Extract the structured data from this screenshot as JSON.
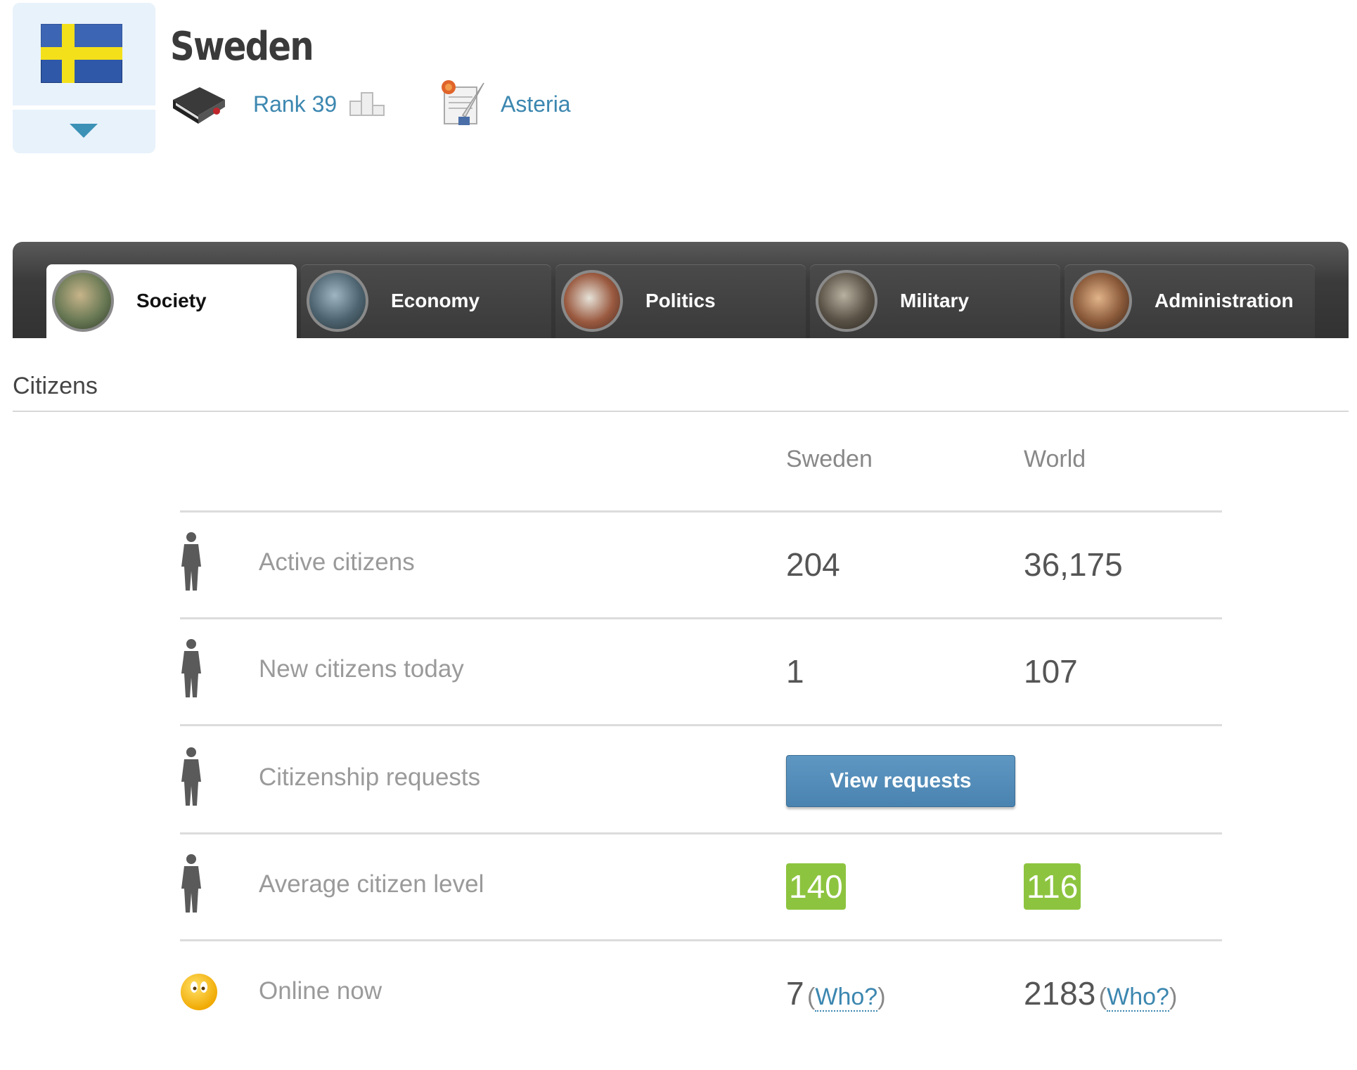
{
  "header": {
    "country": "Sweden",
    "rank_label": "Rank 39",
    "alliance": "Asteria"
  },
  "tabs": [
    {
      "label": "Society",
      "active": true
    },
    {
      "label": "Economy",
      "active": false
    },
    {
      "label": "Politics",
      "active": false
    },
    {
      "label": "Military",
      "active": false
    },
    {
      "label": "Administration",
      "active": false
    }
  ],
  "section": {
    "title": "Citizens",
    "col_country": "Sweden",
    "col_world": "World"
  },
  "rows": {
    "active": {
      "label": "Active citizens",
      "country": "204",
      "world": "36,175"
    },
    "new": {
      "label": "New citizens today",
      "country": "1",
      "world": "107"
    },
    "requests": {
      "label": "Citizenship requests",
      "button": "View requests"
    },
    "level": {
      "label": "Average citizen level",
      "country": "140",
      "world": "116"
    },
    "online": {
      "label": "Online now",
      "country": "7",
      "world": "2183",
      "who_open": "(",
      "who": "Who?",
      "who_close": ")"
    }
  },
  "colors": {
    "link": "#3c87b0",
    "level_badge": "#8dc43f",
    "button": "#4f89b6",
    "tabbar": "#3b3b3b"
  },
  "icons": {
    "flag": "sweden-flag-icon",
    "rank": "book-icon",
    "podium": "podium-icon",
    "alliance": "scroll-quill-icon",
    "person": "person-silhouette-icon",
    "online": "smiley-icon"
  }
}
